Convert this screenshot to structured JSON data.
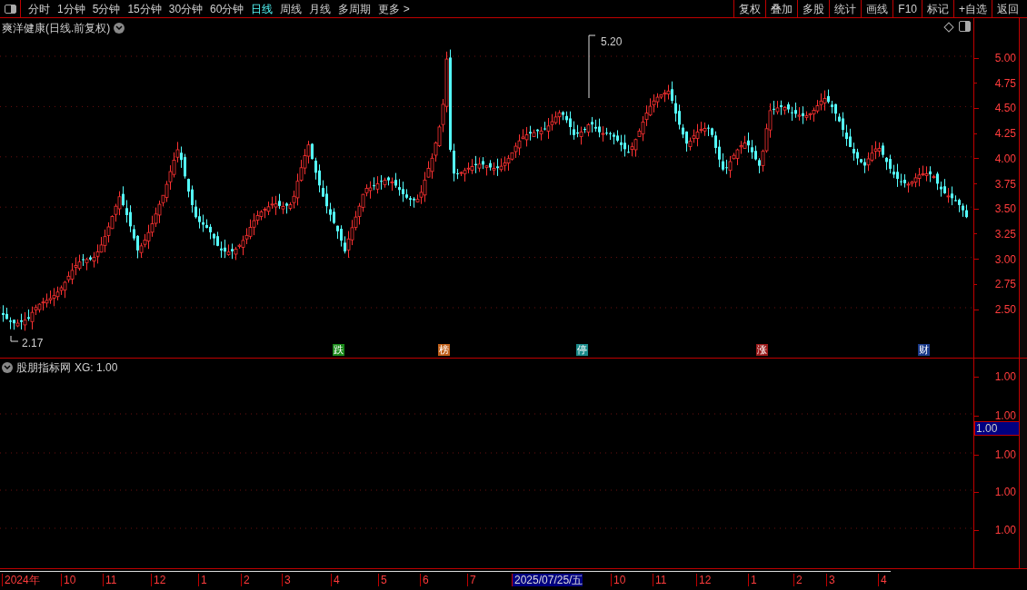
{
  "toolbar": {
    "periods": [
      {
        "label": "分时",
        "selected": false
      },
      {
        "label": "1分钟",
        "selected": false
      },
      {
        "label": "5分钟",
        "selected": false
      },
      {
        "label": "15分钟",
        "selected": false
      },
      {
        "label": "30分钟",
        "selected": false
      },
      {
        "label": "60分钟",
        "selected": false
      },
      {
        "label": "日线",
        "selected": true
      },
      {
        "label": "周线",
        "selected": false
      },
      {
        "label": "月线",
        "selected": false
      },
      {
        "label": "多周期",
        "selected": false
      },
      {
        "label": "更多 >",
        "selected": false
      }
    ],
    "actions": [
      "复权",
      "叠加",
      "多股",
      "统计",
      "画线",
      "F10",
      "标记",
      "+自选",
      "返回"
    ]
  },
  "main_chart": {
    "title": "爽洋健康(日线.前复权)",
    "high_label": "5.20",
    "low_label": "2.17",
    "price_ticks": [
      "5.00",
      "4.75",
      "4.50",
      "4.25",
      "4.00",
      "3.75",
      "3.50",
      "3.25",
      "3.00",
      "2.75",
      "2.50"
    ],
    "markers": [
      {
        "text": "跌",
        "color": "#1a8a1a"
      },
      {
        "text": "榜",
        "color": "#c0601a"
      },
      {
        "text": "停",
        "color": "#1a8a8a"
      },
      {
        "text": "涨",
        "color": "#9a1a1a"
      },
      {
        "text": "财",
        "color": "#1a3a8a"
      }
    ]
  },
  "indicator": {
    "title": "股朋指标网",
    "value_label": "XG: 1.00",
    "ticks": [
      "1.00",
      "1.00",
      "1.00",
      "1.00",
      "1.00"
    ],
    "current": "1.00"
  },
  "date_axis": [
    {
      "label": "2024年",
      "selected": false
    },
    {
      "label": "10",
      "selected": false
    },
    {
      "label": "11",
      "selected": false
    },
    {
      "label": "12",
      "selected": false
    },
    {
      "label": "1",
      "selected": false
    },
    {
      "label": "2",
      "selected": false
    },
    {
      "label": "3",
      "selected": false
    },
    {
      "label": "4",
      "selected": false
    },
    {
      "label": "5",
      "selected": false
    },
    {
      "label": "6",
      "selected": false
    },
    {
      "label": "7",
      "selected": false
    },
    {
      "label": "2025/07/25/五",
      "selected": true
    },
    {
      "label": "10",
      "selected": false
    },
    {
      "label": "11",
      "selected": false
    },
    {
      "label": "12",
      "selected": false
    },
    {
      "label": "1",
      "selected": false
    },
    {
      "label": "2",
      "selected": false
    },
    {
      "label": "3",
      "selected": false
    },
    {
      "label": "4",
      "selected": false
    }
  ]
}
